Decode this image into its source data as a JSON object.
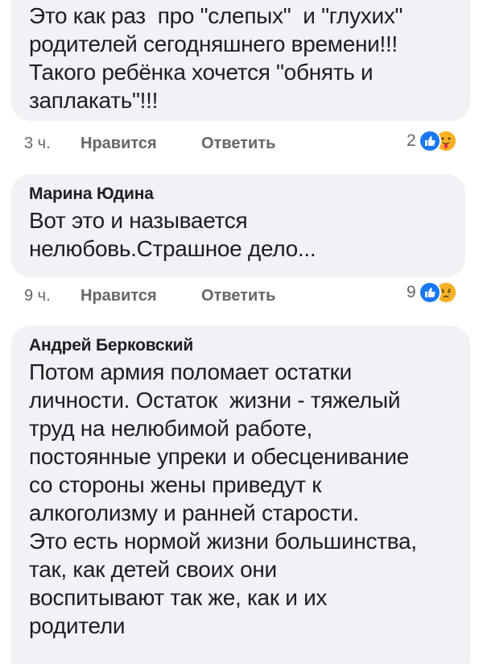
{
  "comments": [
    {
      "author": "",
      "text": "Это как раз  про \"слепых\"  и \"глухих\"\nродителей сегодняшнего времени!!!\nТакого ребёнка хочется \"обнять и\nзаплакать\"!!!",
      "time": "3 ч.",
      "like_label": "Нравится",
      "reply_label": "Ответить",
      "reaction_count": "2",
      "reactions": [
        "like-icon",
        "care-icon"
      ]
    },
    {
      "author": "Марина Юдина",
      "text": "Вот это и называется\nнелюбовь.Страшное дело...",
      "time": "9 ч.",
      "like_label": "Нравится",
      "reply_label": "Ответить",
      "reaction_count": "9",
      "reactions": [
        "like-icon",
        "sad-icon"
      ]
    },
    {
      "author": "Андрей Берковский",
      "text": "Потом армия поломает остатки\nличности. Остаток  жизни - тяжелый\nтруд на нелюбимой работе,\nпостоянные упреки и обесценивание\nсо стороны жены приведут к\nалкоголизму и ранней старости.\nЭто есть нормой жизни большинства,\nтак, как детей своих они\nвоспитывают так же, как и их\nродители"
    }
  ],
  "colors": {
    "bubble": "#f0f2f5",
    "secondary_text": "#65676b",
    "like_blue": "#1877f2",
    "emoji_yellow": "#f7b125"
  }
}
